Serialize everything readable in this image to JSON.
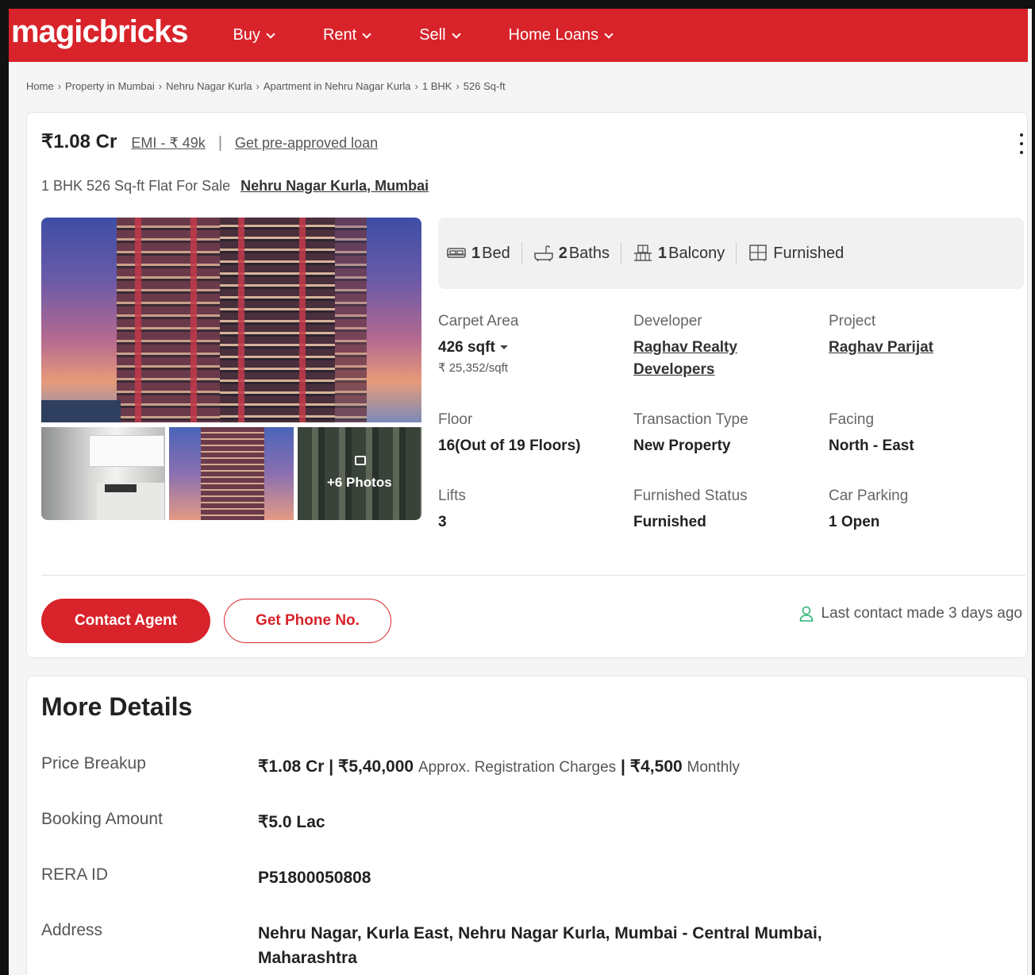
{
  "header": {
    "logo": "magicbricks",
    "nav": [
      {
        "label": "Buy"
      },
      {
        "label": "Rent"
      },
      {
        "label": "Sell"
      },
      {
        "label": "Home Loans"
      }
    ]
  },
  "breadcrumb": [
    "Home",
    "Property in Mumbai",
    "Nehru Nagar Kurla",
    "Apartment in Nehru Nagar Kurla",
    "1 BHK",
    "526 Sq-ft"
  ],
  "listing": {
    "price": "₹1.08 Cr",
    "emi": "EMI - ₹ 49k",
    "separator": "|",
    "preapproved_loan": "Get pre-approved loan",
    "subtitle": "1 BHK 526 Sq-ft Flat For Sale",
    "location": "Nehru Nagar Kurla, Mumbai",
    "photos_label": "+6 Photos",
    "features": [
      {
        "icon": "bed-icon",
        "value": "1",
        "label": "Bed"
      },
      {
        "icon": "bath-icon",
        "value": "2",
        "label": "Baths"
      },
      {
        "icon": "balcony-icon",
        "value": "1",
        "label": "Balcony"
      },
      {
        "icon": "furnished-icon",
        "value": "",
        "label": "Furnished"
      }
    ],
    "specs": {
      "carpet_area": {
        "label": "Carpet Area",
        "value": "426 sqft",
        "sub": "₹ 25,352/sqft"
      },
      "developer": {
        "label": "Developer",
        "value_line1": "Raghav Realty",
        "value_line2": "Developers"
      },
      "project": {
        "label": "Project",
        "value": "Raghav Parijat"
      },
      "floor": {
        "label": "Floor",
        "value": "16(Out of 19 Floors)"
      },
      "transaction_type": {
        "label": "Transaction Type",
        "value": "New Property"
      },
      "facing": {
        "label": "Facing",
        "value": "North - East"
      },
      "lifts": {
        "label": "Lifts",
        "value": "3"
      },
      "furnished_status": {
        "label": "Furnished Status",
        "value": "Furnished"
      },
      "car_parking": {
        "label": "Car Parking",
        "value": "1 Open"
      }
    },
    "actions": {
      "contact_agent": "Contact Agent",
      "get_phone": "Get Phone No."
    },
    "last_contact": "Last contact made 3 days ago"
  },
  "more_details": {
    "title": "More Details",
    "price_breakup": {
      "label": "Price Breakup",
      "price": "₹1.08 Cr",
      "sep1": "|",
      "registration": "₹5,40,000",
      "registration_label": "Approx. Registration Charges",
      "sep2": "|",
      "monthly": "₹4,500",
      "monthly_label": "Monthly"
    },
    "booking_amount": {
      "label": "Booking Amount",
      "value": "₹5.0 Lac"
    },
    "rera_id": {
      "label": "RERA ID",
      "value": "P51800050808"
    },
    "address": {
      "label": "Address",
      "value_line1": "Nehru Nagar, Kurla East, Nehru Nagar Kurla, Mumbai - Central Mumbai,",
      "value_line2": "Maharashtra"
    }
  },
  "colors": {
    "brand": "#d8232a"
  }
}
